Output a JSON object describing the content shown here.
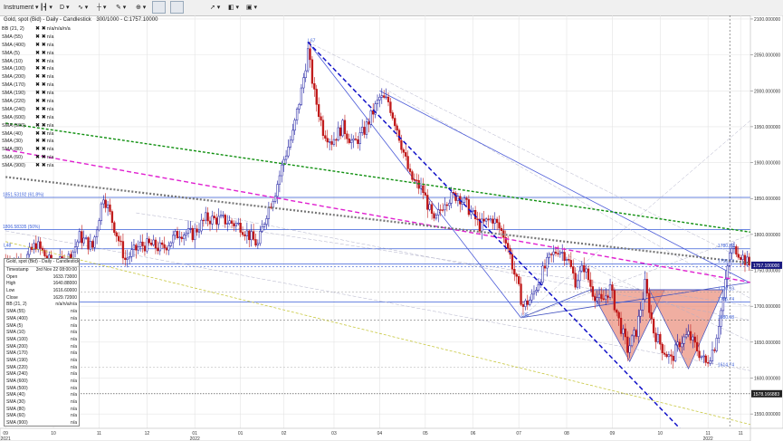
{
  "toolbar": {
    "instrument": "Instrument",
    "period": "D",
    "flag_icon": "uk-flag-icon"
  },
  "header": {
    "title": "Gold, spot (Bid) - Daily - Candlestick",
    "info": "300/1000 - C:1757.10000"
  },
  "legend": [
    {
      "name": "BB (21, 2)",
      "val": "n/a/n/a/n/a"
    },
    {
      "name": "SMA (55)",
      "val": "n/a"
    },
    {
      "name": "SMA (400)",
      "val": "n/a"
    },
    {
      "name": "SMA (5)",
      "val": "n/a"
    },
    {
      "name": "SMA (10)",
      "val": "n/a"
    },
    {
      "name": "SMA (100)",
      "val": "n/a"
    },
    {
      "name": "SMA (200)",
      "val": "n/a"
    },
    {
      "name": "SMA (170)",
      "val": "n/a"
    },
    {
      "name": "SMA (190)",
      "val": "n/a"
    },
    {
      "name": "SMA (220)",
      "val": "n/a"
    },
    {
      "name": "SMA (240)",
      "val": "n/a"
    },
    {
      "name": "SMA (600)",
      "val": "n/a"
    },
    {
      "name": "SMA (500)",
      "val": "n/a"
    },
    {
      "name": "SMA (40)",
      "val": "n/a"
    },
    {
      "name": "SMA (30)",
      "val": "n/a"
    },
    {
      "name": "SMA (80)",
      "val": "n/a"
    },
    {
      "name": "SMA (60)",
      "val": "n/a"
    },
    {
      "name": "SMA (900)",
      "val": "n/a"
    }
  ],
  "databox": {
    "title": "Gold, spot (Bid) - Daily - Candlestick",
    "rows": [
      {
        "k": "Timestamp",
        "v": "3rd Nov 22 08:00:00"
      },
      {
        "k": "Open",
        "v": "1633.73000"
      },
      {
        "k": "High",
        "v": "1640.88000"
      },
      {
        "k": "Low",
        "v": "1616.60000"
      },
      {
        "k": "Close",
        "v": "1629.72000"
      },
      {
        "k": "BB (21, 2)",
        "v": "n/a/n/a/n/a"
      },
      {
        "k": "SMA (55)",
        "v": "n/a"
      },
      {
        "k": "SMA (400)",
        "v": "n/a"
      },
      {
        "k": "SMA (5)",
        "v": "n/a"
      },
      {
        "k": "SMA (10)",
        "v": "n/a"
      },
      {
        "k": "SMA (100)",
        "v": "n/a"
      },
      {
        "k": "SMA (200)",
        "v": "n/a"
      },
      {
        "k": "SMA (170)",
        "v": "n/a"
      },
      {
        "k": "SMA (190)",
        "v": "n/a"
      },
      {
        "k": "SMA (220)",
        "v": "n/a"
      },
      {
        "k": "SMA (240)",
        "v": "n/a"
      },
      {
        "k": "SMA (600)",
        "v": "n/a"
      },
      {
        "k": "SMA (500)",
        "v": "n/a"
      },
      {
        "k": "SMA (40)",
        "v": "n/a"
      },
      {
        "k": "SMA (30)",
        "v": "n/a"
      },
      {
        "k": "SMA (80)",
        "v": "n/a"
      },
      {
        "k": "SMA (60)",
        "v": "n/a"
      },
      {
        "k": "SMA (900)",
        "v": "n/a"
      }
    ]
  },
  "colors": {
    "up": "#1a1aa0",
    "down": "#c01818",
    "grid": "#e4e4e4",
    "level_line": "#3a5fd8",
    "pattern_fill": "#e8826e",
    "blue_dash": "#1010c8",
    "green_dash": "#109010",
    "magenta_dash": "#e020d0",
    "gray_dash": "#777777",
    "olive_dash": "#c8c840"
  },
  "chart_data": {
    "type": "candlestick",
    "title": "Gold, spot (Bid) - Daily - Candlestick",
    "ylim": [
      1530,
      2105
    ],
    "y_ticks": [
      1550,
      1600,
      1650,
      1700,
      1750,
      1800,
      1850,
      1900,
      1950,
      2000,
      2050,
      2100
    ],
    "y_tick_labels": [
      "1550.000000",
      "1600.000000",
      "1650.000000",
      "1700.000000",
      "1750.000000",
      "1800.000000",
      "1850.000000",
      "1900.000000",
      "1950.000000",
      "2000.000000",
      "2050.000000",
      "2100.000000"
    ],
    "x_ticks": [
      {
        "i": 0,
        "label": "09",
        "sub": "2021"
      },
      {
        "i": 22,
        "label": "10"
      },
      {
        "i": 43,
        "label": "11"
      },
      {
        "i": 65,
        "label": "12"
      },
      {
        "i": 87,
        "label": "01",
        "sub": "2022"
      },
      {
        "i": 108,
        "label": "01"
      },
      {
        "i": 128,
        "label": "02"
      },
      {
        "i": 151,
        "label": "03"
      },
      {
        "i": 172,
        "label": "04"
      },
      {
        "i": 193,
        "label": "05"
      },
      {
        "i": 215,
        "label": "06"
      },
      {
        "i": 236,
        "label": "07"
      },
      {
        "i": 258,
        "label": "08"
      },
      {
        "i": 279,
        "label": "09"
      },
      {
        "i": 301,
        "label": "10"
      },
      {
        "i": 323,
        "label": "11",
        "sub": "2022"
      },
      {
        "i": 338,
        "label": "11"
      }
    ],
    "keypoints": [
      [
        0,
        1765
      ],
      [
        8,
        1760
      ],
      [
        14,
        1787
      ],
      [
        22,
        1755
      ],
      [
        30,
        1770
      ],
      [
        34,
        1797
      ],
      [
        40,
        1782
      ],
      [
        45,
        1855
      ],
      [
        50,
        1810
      ],
      [
        55,
        1765
      ],
      [
        62,
        1785
      ],
      [
        67,
        1785
      ],
      [
        72,
        1780
      ],
      [
        80,
        1803
      ],
      [
        86,
        1800
      ],
      [
        92,
        1822
      ],
      [
        100,
        1820
      ],
      [
        108,
        1812
      ],
      [
        116,
        1785
      ],
      [
        120,
        1830
      ],
      [
        124,
        1860
      ],
      [
        128,
        1905
      ],
      [
        132,
        1940
      ],
      [
        136,
        2000
      ],
      [
        139,
        2055
      ],
      [
        142,
        1995
      ],
      [
        146,
        1945
      ],
      [
        150,
        1930
      ],
      [
        155,
        1950
      ],
      [
        160,
        1925
      ],
      [
        165,
        1945
      ],
      [
        172,
        1990
      ],
      [
        176,
        1985
      ],
      [
        180,
        1948
      ],
      [
        186,
        1880
      ],
      [
        192,
        1860
      ],
      [
        197,
        1815
      ],
      [
        202,
        1848
      ],
      [
        208,
        1855
      ],
      [
        212,
        1840
      ],
      [
        218,
        1812
      ],
      [
        224,
        1822
      ],
      [
        230,
        1795
      ],
      [
        234,
        1745
      ],
      [
        238,
        1700
      ],
      [
        242,
        1712
      ],
      [
        246,
        1742
      ],
      [
        250,
        1765
      ],
      [
        254,
        1780
      ],
      [
        258,
        1770
      ],
      [
        262,
        1735
      ],
      [
        266,
        1755
      ],
      [
        270,
        1720
      ],
      [
        274,
        1705
      ],
      [
        278,
        1725
      ],
      [
        282,
        1680
      ],
      [
        286,
        1640
      ],
      [
        290,
        1665
      ],
      [
        294,
        1730
      ],
      [
        298,
        1665
      ],
      [
        302,
        1642
      ],
      [
        306,
        1625
      ],
      [
        310,
        1650
      ],
      [
        314,
        1660
      ],
      [
        318,
        1640
      ],
      [
        322,
        1620
      ],
      [
        326,
        1645
      ],
      [
        330,
        1710
      ],
      [
        333,
        1775
      ],
      [
        336,
        1780
      ],
      [
        339,
        1768
      ],
      [
        342,
        1757
      ]
    ],
    "last_candle_close": 1757.1,
    "levels": [
      {
        "name": "1851.53192 (61.8%)",
        "value": 1851.53
      },
      {
        "name": "1806.58335 (50%)",
        "value": 1806.58
      },
      {
        "name": "L48",
        "value": 1780
      },
      {
        "name": "1780.22",
        "value": 1780.22
      },
      {
        "name": "1758.73",
        "value": 1758.73
      },
      {
        "name": "1720.10",
        "value": 1720.1
      },
      {
        "name": "1705.74",
        "value": 1705.74
      },
      {
        "name": "1680.68",
        "value": 1680.68
      },
      {
        "name": "1614.74",
        "value": 1614.74
      }
    ],
    "price_badges": [
      {
        "text": "1757.100000",
        "value": 1757.1
      },
      {
        "text": "1578.166883",
        "value": 1578.17
      }
    ],
    "pattern_labels": [
      {
        "text": "L67",
        "i": 139,
        "v": 2068
      },
      {
        "text": "L35",
        "i": 237,
        "v": 1686
      }
    ]
  }
}
